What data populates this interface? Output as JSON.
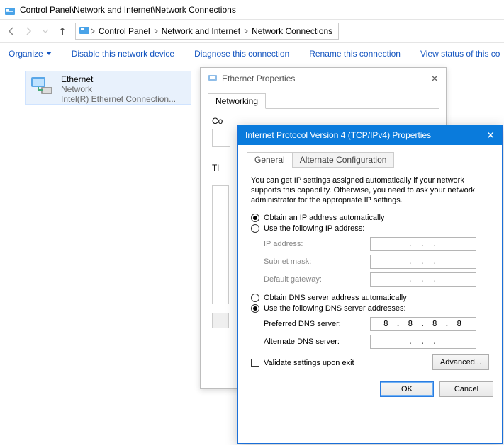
{
  "window_title": "Control Panel\\Network and Internet\\Network Connections",
  "breadcrumb": {
    "seg1": "Control Panel",
    "seg2": "Network and Internet",
    "seg3": "Network Connections"
  },
  "toolbar": {
    "organize": "Organize",
    "disable": "Disable this network device",
    "diagnose": "Diagnose this connection",
    "rename": "Rename this connection",
    "status": "View status of this co"
  },
  "adapter": {
    "name": "Ethernet",
    "type": "Network",
    "device": "Intel(R) Ethernet Connection..."
  },
  "eth_props": {
    "title": "Ethernet Properties",
    "tab_networking": "Networking",
    "connect_using_lead": "Co",
    "this_lead": "Tl"
  },
  "ipv4": {
    "title": "Internet Protocol Version 4 (TCP/IPv4) Properties",
    "tab_general": "General",
    "tab_alt": "Alternate Configuration",
    "description": "You can get IP settings assigned automatically if your network supports this capability. Otherwise, you need to ask your network administrator for the appropriate IP settings.",
    "radio_obtain_ip": "Obtain an IP address automatically",
    "radio_use_ip": "Use the following IP address:",
    "lbl_ip": "IP address:",
    "lbl_subnet": "Subnet mask:",
    "lbl_gateway": "Default gateway:",
    "ip_value": ".     .     .",
    "subnet_value": ".     .     .",
    "gateway_value": ".     .     .",
    "radio_obtain_dns": "Obtain DNS server address automatically",
    "radio_use_dns": "Use the following DNS server addresses:",
    "lbl_pref_dns": "Preferred DNS server:",
    "lbl_alt_dns": "Alternate DNS server:",
    "pref_dns_value": "8 . 8 . 8 . 8",
    "alt_dns_value": ".     .     .",
    "chk_validate": "Validate settings upon exit",
    "btn_advanced": "Advanced...",
    "btn_ok": "OK",
    "btn_cancel": "Cancel"
  }
}
